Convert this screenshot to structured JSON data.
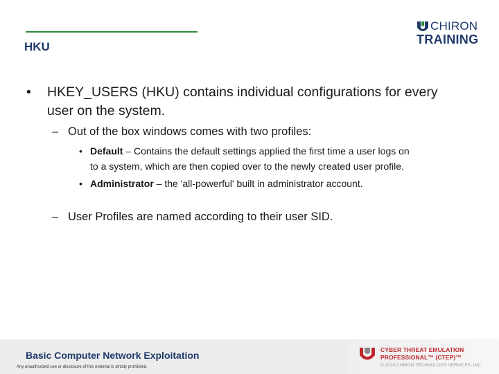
{
  "slide": {
    "title": "HKU"
  },
  "logo": {
    "line1": "CHIRON",
    "line2": "TRAINING"
  },
  "bullets": {
    "main_line1": "HKEY_USERS (HKU) contains individual configurations for every",
    "main_line2": "user on the system.",
    "sub1": "Out of the box windows comes with two profiles:",
    "default_term": "Default",
    "default_line1": " – Contains the default settings applied the first time a user logs on",
    "default_line2": "to a system, which are then copied over to the newly created user profile.",
    "admin_term": "Administrator",
    "admin_text": " – the 'all-powerful' built in administrator account.",
    "sub2": "User Profiles are named according to their user SID."
  },
  "footer": {
    "course": "Basic Computer Network Exploitation",
    "disclaimer": "Any unauthorized use or disclosure of this material is strictly prohibited.",
    "ctep_line1": "CYBER THREAT EMULATION",
    "ctep_line2": "PROFESSIONAL™ (CTEP)™",
    "copyright": "© 2019 CHIRON TECHNOLOGY SERVICES, INC."
  },
  "colors": {
    "title": "#1f3a6b",
    "rule": "#2e8b3a",
    "accent_red": "#c0272d"
  }
}
